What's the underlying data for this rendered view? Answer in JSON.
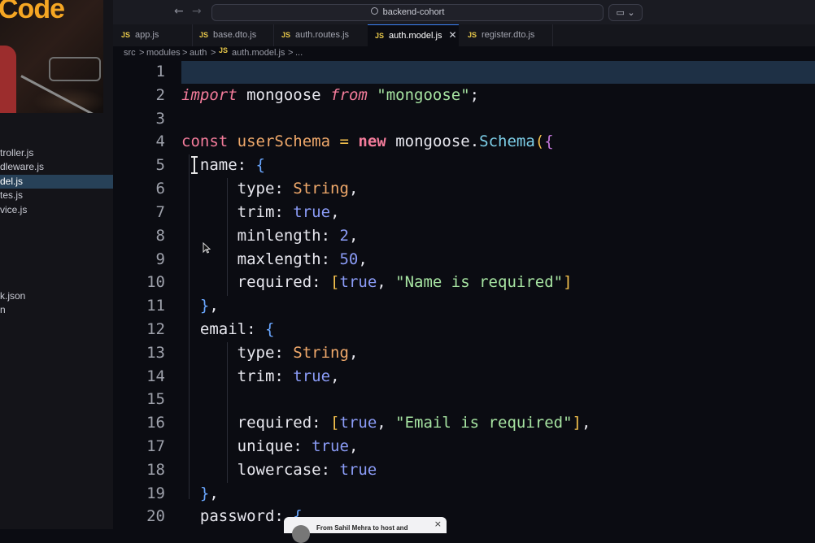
{
  "webcam": {
    "brand_text": "Code"
  },
  "sidebar": {
    "files": [
      {
        "label": "troller.js",
        "active": false
      },
      {
        "label": "dleware.js",
        "active": false
      },
      {
        "label": "del.js",
        "active": true
      },
      {
        "label": "tes.js",
        "active": false
      },
      {
        "label": "vice.js",
        "active": false
      },
      {
        "label": "k.json",
        "active": false
      },
      {
        "label": "n",
        "active": false
      }
    ]
  },
  "titlebar": {
    "back_icon": "arrow-left-icon",
    "forward_icon": "arrow-right-icon",
    "search_text": "backend-cohort",
    "copilot_icon": "chat-icon"
  },
  "tabs": [
    {
      "label": "app.js",
      "icon": "js-icon"
    },
    {
      "label": "base.dto.js",
      "icon": "js-icon"
    },
    {
      "label": "auth.routes.js",
      "icon": "js-icon"
    },
    {
      "label": "auth.model.js",
      "icon": "js-icon",
      "active": true
    },
    {
      "label": "register.dto.js",
      "icon": "js-icon"
    }
  ],
  "breadcrumb": {
    "parts": [
      "src",
      "modules",
      "auth",
      "auth.model.js",
      "..."
    ],
    "separator": ">"
  },
  "editor": {
    "line_numbers": [
      "1",
      "2",
      "3",
      "4",
      "5",
      "6",
      "7",
      "8",
      "9",
      "10",
      "11",
      "12",
      "13",
      "14",
      "15",
      "16",
      "17",
      "18",
      "19",
      "20"
    ],
    "tokens": {
      "import": "import",
      "mongoose": "mongoose",
      "from": "from",
      "mongoose_str": "\"mongoose\"",
      "semi": ";",
      "const": "const",
      "userSchema": "userSchema",
      "eq": "=",
      "new": "new",
      "mongoose2": "mongoose",
      "dot": ".",
      "Schema": "Schema",
      "open": "(",
      "brace_open": "{",
      "name": "name:",
      "type": "type:",
      "String": "String",
      "comma": ",",
      "trim": "trim:",
      "true": "true",
      "minlength": "minlength:",
      "two": "2",
      "maxlength": "maxlength:",
      "fifty": "50",
      "required": "required:",
      "name_required": "\"Name is required\"",
      "close_obj": "}",
      "email": "email:",
      "email_required": "\"Email is required\"",
      "unique": "unique:",
      "lowercase": "lowercase:",
      "password": "password:",
      "lbracket": "[",
      "rbracket": "]"
    }
  },
  "toast": {
    "text": "From Sahil Mehra   to host and",
    "close": "×"
  }
}
